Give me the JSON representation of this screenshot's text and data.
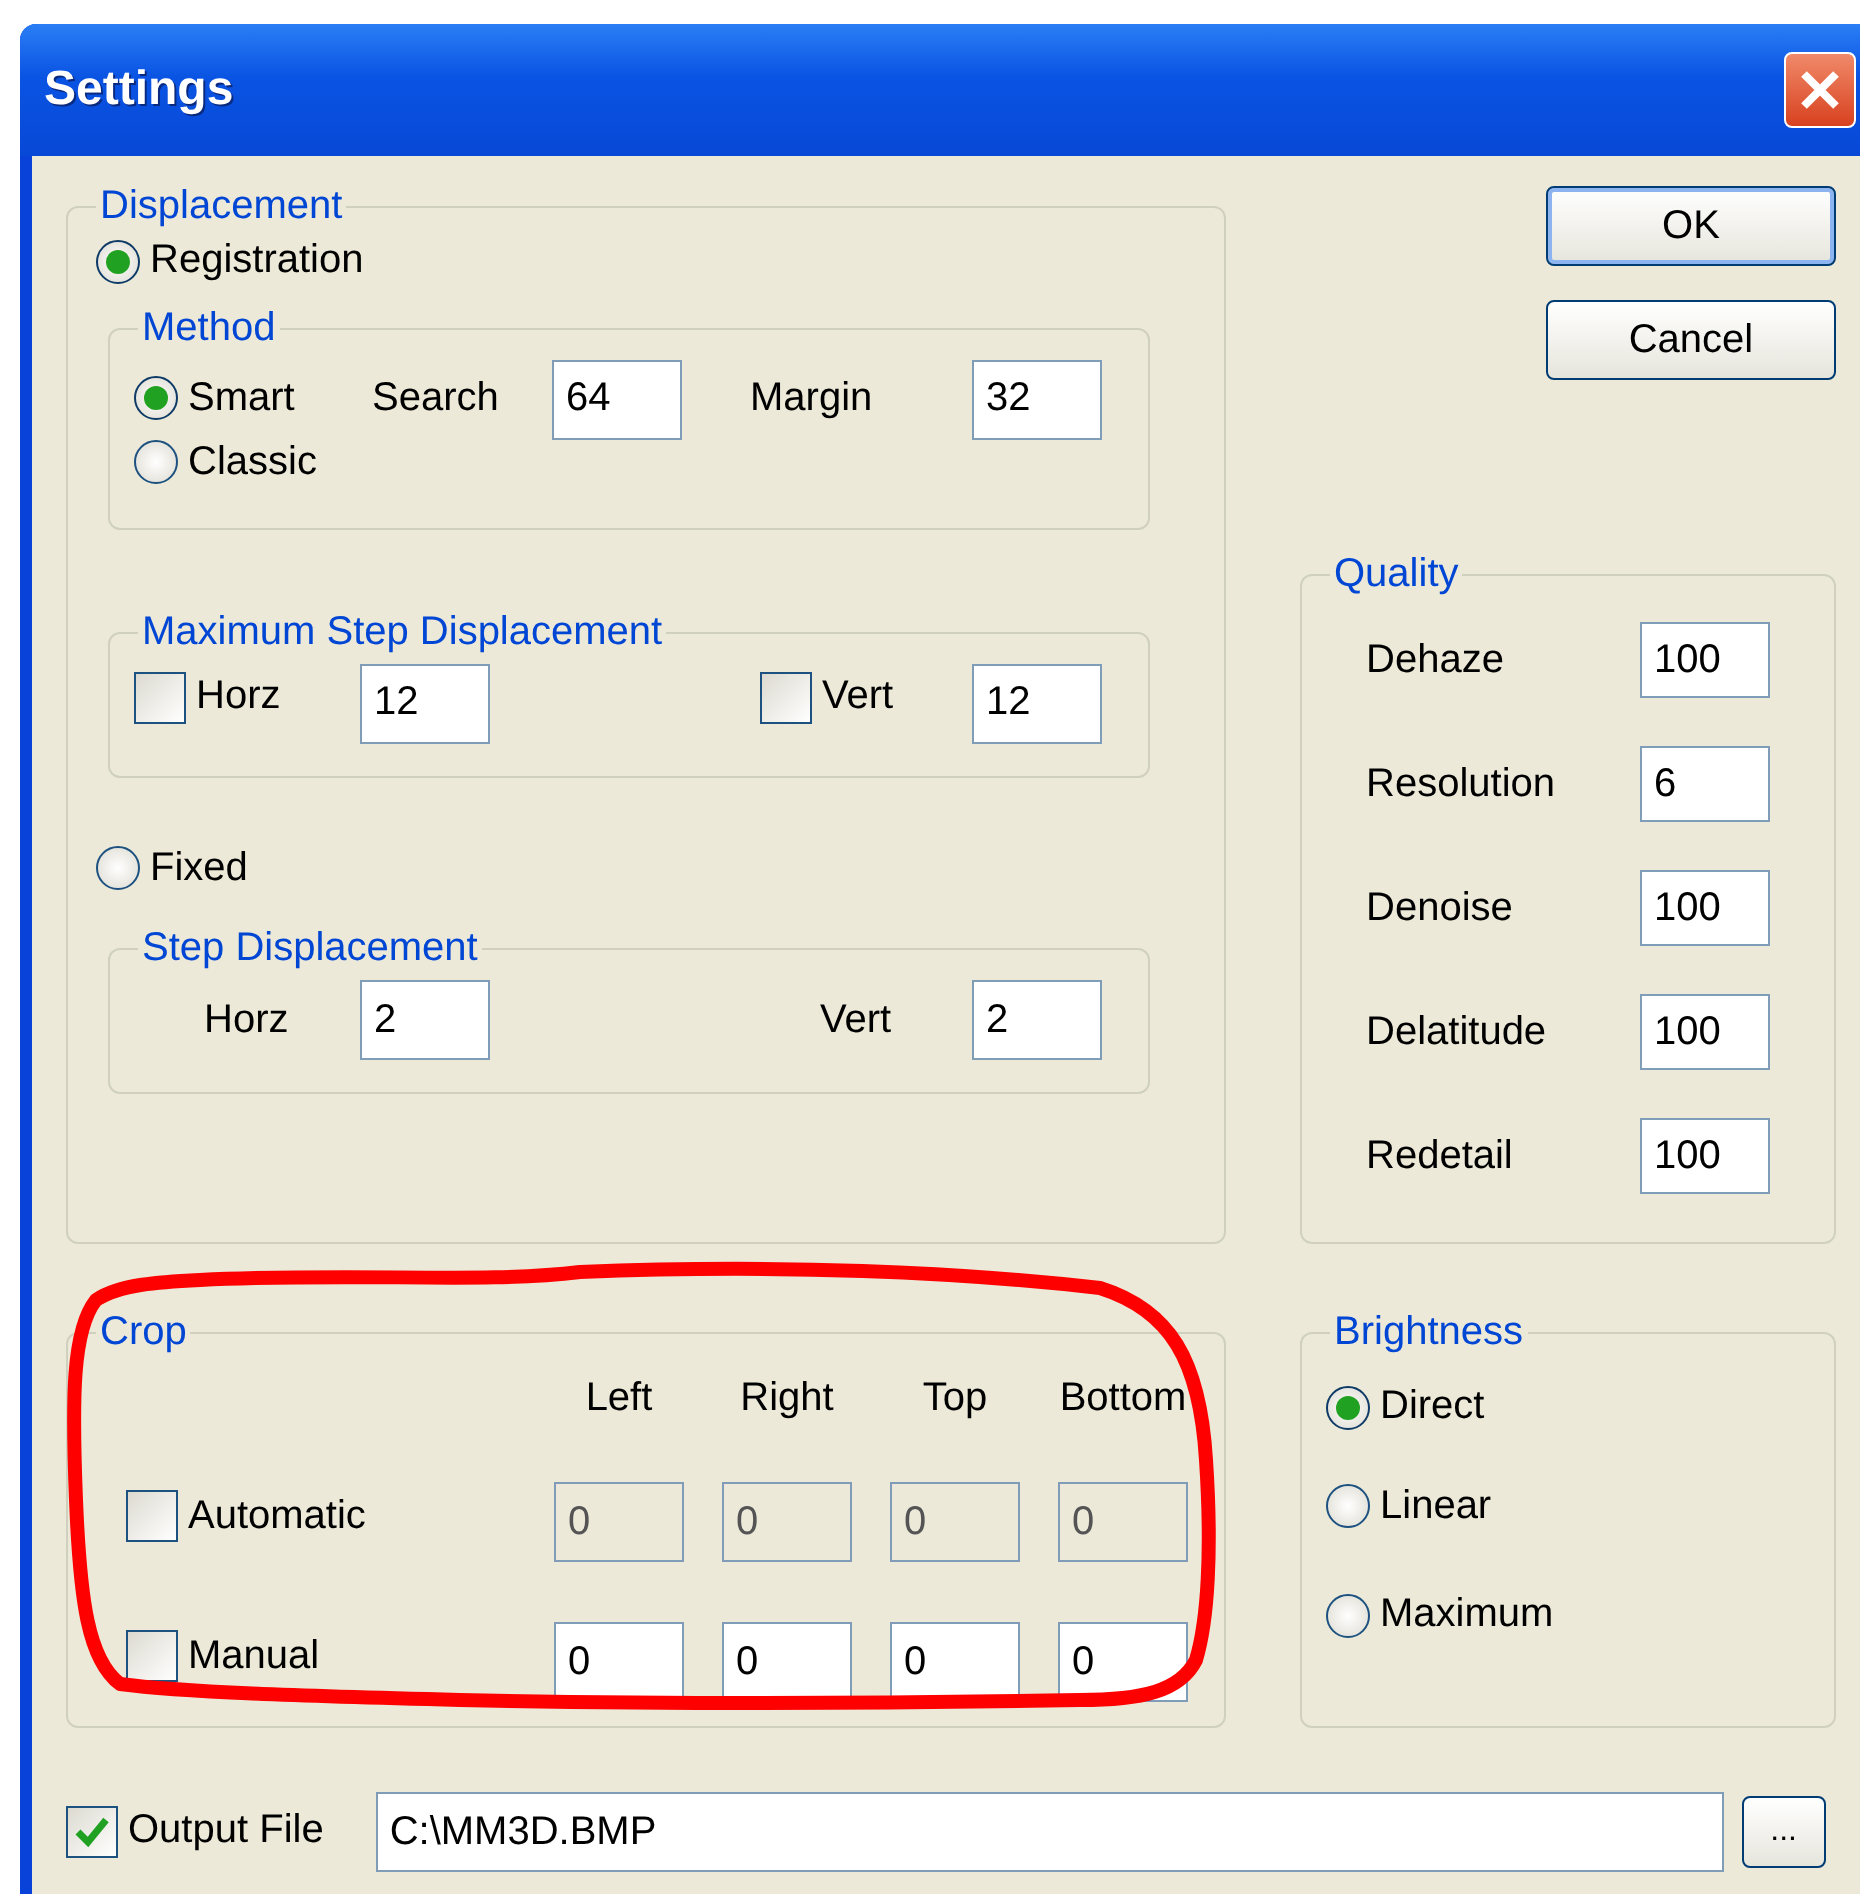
{
  "window": {
    "title": "Settings"
  },
  "displacement": {
    "label": "Displacement",
    "registration": {
      "label": "Registration",
      "selected": true
    },
    "method": {
      "label": "Method",
      "smart": {
        "label": "Smart",
        "selected": true
      },
      "classic": {
        "label": "Classic",
        "selected": false
      },
      "search": {
        "label": "Search",
        "value": "64"
      },
      "margin": {
        "label": "Margin",
        "value": "32"
      }
    },
    "max_step": {
      "label": "Maximum Step Displacement",
      "horz": {
        "label": "Horz",
        "checked": false,
        "value": "12"
      },
      "vert": {
        "label": "Vert",
        "checked": false,
        "value": "12"
      }
    },
    "fixed": {
      "label": "Fixed",
      "selected": false
    },
    "step": {
      "label": "Step Displacement",
      "horz": {
        "label": "Horz",
        "value": "2"
      },
      "vert": {
        "label": "Vert",
        "value": "2"
      }
    }
  },
  "crop": {
    "label": "Crop",
    "columns": [
      "Left",
      "Right",
      "Top",
      "Bottom"
    ],
    "rows": [
      {
        "label": "Automatic",
        "checked": false,
        "disabled": true,
        "values": [
          "0",
          "0",
          "0",
          "0"
        ]
      },
      {
        "label": "Manual",
        "checked": false,
        "disabled": false,
        "values": [
          "0",
          "0",
          "0",
          "0"
        ]
      }
    ]
  },
  "output_file": {
    "label": "Output File",
    "checked": true,
    "value": "C:\\MM3D.BMP"
  },
  "browse_button": {
    "label": "..."
  },
  "buttons": [
    {
      "label": "OK",
      "default": true
    },
    {
      "label": "Cancel",
      "default": false
    }
  ],
  "quality": {
    "label": "Quality",
    "fields": [
      {
        "label": "Dehaze",
        "value": "100"
      },
      {
        "label": "Resolution",
        "value": "6"
      },
      {
        "label": "Denoise",
        "value": "100"
      },
      {
        "label": "Delatitude",
        "value": "100"
      },
      {
        "label": "Redetail",
        "value": "100"
      }
    ]
  },
  "brightness": {
    "label": "Brightness",
    "options": [
      {
        "label": "Direct",
        "selected": true
      },
      {
        "label": "Linear",
        "selected": false
      },
      {
        "label": "Maximum",
        "selected": false
      }
    ]
  },
  "annotation": {
    "kind": "freehand-ellipse"
  }
}
